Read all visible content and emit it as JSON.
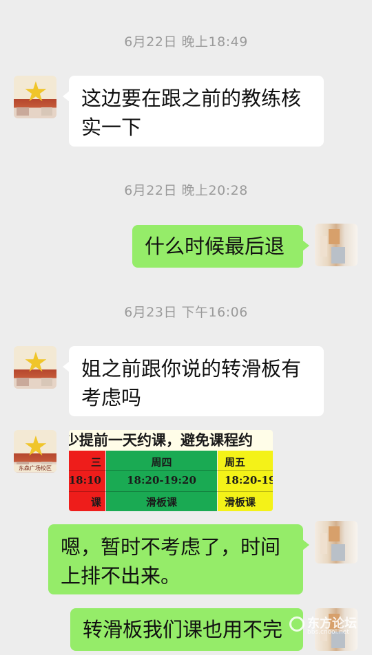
{
  "timestamps": [
    "6月22日 晚上18:49",
    "6月22日 晚上20:28",
    "6月23日 下午16:06"
  ],
  "messages": {
    "m1": "这边要在跟之前的教练核实一下",
    "m2": "什么时候最后退",
    "m3": "姐之前跟你说的转滑板有考虑吗",
    "m5": "嗯，暂时不考虑了，时间上排不出来。",
    "m6": "转滑板我们课也用不完"
  },
  "image_message": {
    "top_text": "少提前一天约课，避免课程约",
    "columns": [
      {
        "day": "三",
        "time": "18:10",
        "type": "课",
        "color": "#ee1d1b"
      },
      {
        "day": "周四",
        "time": "18:20-19:20",
        "type": "滑板课",
        "color": "#1aaa53"
      },
      {
        "day": "周五",
        "time": "18:20-19",
        "type": "滑板课",
        "color": "#f4f218"
      }
    ]
  },
  "avatar_caption": "东森广场校区",
  "watermark": {
    "main": "东方论坛",
    "sub": "bbs.cnool.net"
  }
}
